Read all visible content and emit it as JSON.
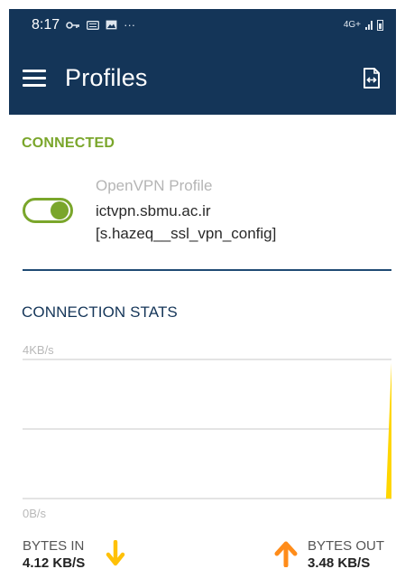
{
  "status_bar": {
    "time": "8:17",
    "icons": [
      "vpn-key-icon",
      "keyboard-icon",
      "image-icon",
      "more-icon"
    ],
    "more": "···",
    "network": "4G+",
    "right_icons": [
      "signal-icon",
      "battery-icon"
    ]
  },
  "app_bar": {
    "title": "Profiles",
    "menu_icon": "hamburger-menu-icon",
    "action_icon": "import-file-icon"
  },
  "connection": {
    "status_label": "CONNECTED",
    "enabled": true,
    "profile_type": "OpenVPN Profile",
    "host": "ictvpn.sbmu.ac.ir",
    "config": "[s.hazeq__ssl_vpn_config]"
  },
  "stats": {
    "section_label": "CONNECTION STATS",
    "bytes_in_label": "BYTES IN",
    "bytes_in_value": "4.12 KB/S",
    "bytes_out_label": "BYTES OUT",
    "bytes_out_value": "3.48 KB/S"
  },
  "colors": {
    "primary": "#143558",
    "accent_green": "#7aa62b",
    "chart_fill": "#ffd600",
    "arrow_in": "#ffc107",
    "arrow_out": "#ff8c1a"
  },
  "chart_data": {
    "type": "area",
    "ylabel": "",
    "yticks": [
      "4KB/s",
      "0B/s"
    ],
    "ylim": [
      0,
      4
    ],
    "grid": true,
    "series": [
      {
        "x": [
          0,
          0.985,
          1
        ],
        "values": [
          0,
          0,
          3.9
        ]
      }
    ]
  }
}
